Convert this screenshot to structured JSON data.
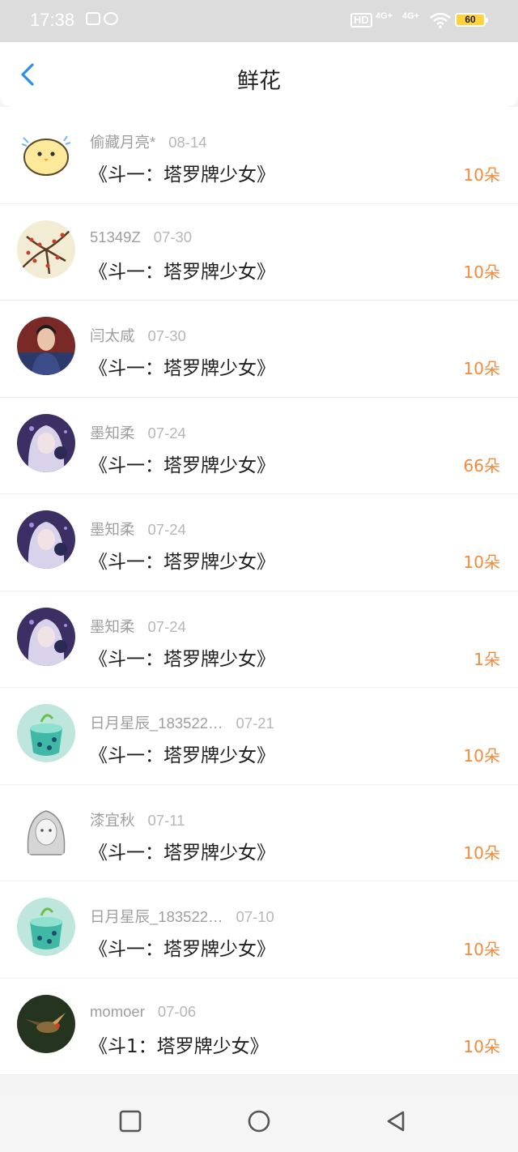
{
  "status_bar": {
    "time": "17:38",
    "hd": "HD",
    "net1": "4G+",
    "net2": "4G+",
    "battery": "60"
  },
  "header": {
    "title": "鲜花"
  },
  "items": [
    {
      "user": "偷藏月亮*",
      "date": "08-14",
      "book": "《斗一：塔罗牌少女》",
      "amount": "10朵"
    },
    {
      "user": "51349Z",
      "date": "07-30",
      "book": "《斗一：塔罗牌少女》",
      "amount": "10朵"
    },
    {
      "user": "闫太咸",
      "date": "07-30",
      "book": "《斗一：塔罗牌少女》",
      "amount": "10朵"
    },
    {
      "user": "墨知柔",
      "date": "07-24",
      "book": "《斗一：塔罗牌少女》",
      "amount": "66朵"
    },
    {
      "user": "墨知柔",
      "date": "07-24",
      "book": "《斗一：塔罗牌少女》",
      "amount": "10朵"
    },
    {
      "user": "墨知柔",
      "date": "07-24",
      "book": "《斗一：塔罗牌少女》",
      "amount": "1朵"
    },
    {
      "user": "日月星辰_183522…",
      "date": "07-21",
      "book": "《斗一：塔罗牌少女》",
      "amount": "10朵"
    },
    {
      "user": "漆宜秋",
      "date": "07-11",
      "book": "《斗一：塔罗牌少女》",
      "amount": "10朵"
    },
    {
      "user": "日月星辰_183522…",
      "date": "07-10",
      "book": "《斗一：塔罗牌少女》",
      "amount": "10朵"
    },
    {
      "user": "momoer",
      "date": "07-06",
      "book": "《斗1：塔罗牌少女》",
      "amount": "10朵"
    }
  ],
  "colors": {
    "accent": "#2b8ef0",
    "amount": "#f58a3b",
    "battery": "#ffd23f"
  }
}
